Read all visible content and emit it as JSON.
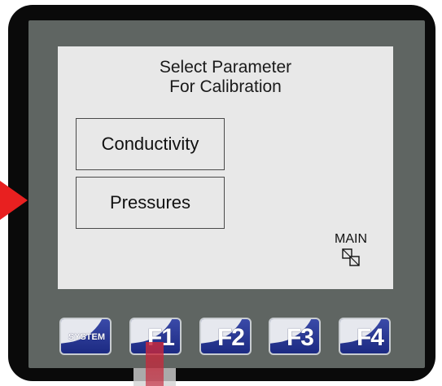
{
  "screen": {
    "title_line1": "Select Parameter",
    "title_line2": "For Calibration",
    "options": [
      {
        "label": "Conductivity"
      },
      {
        "label": "Pressures"
      }
    ],
    "main_label": "MAIN"
  },
  "function_keys": [
    {
      "label": "SYSTEM"
    },
    {
      "label": "F1"
    },
    {
      "label": "F2"
    },
    {
      "label": "F3"
    },
    {
      "label": "F4"
    }
  ],
  "colors": {
    "screen_bg": "#e8e8e8",
    "bezel": "#5f6562",
    "key_blue": "#1c2a82",
    "arrow_red": "#e82020"
  }
}
